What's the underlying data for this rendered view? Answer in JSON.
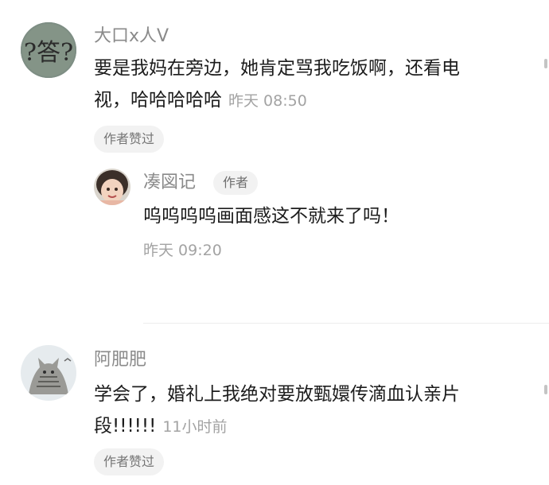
{
  "comments": [
    {
      "username": "大口x人V",
      "lines": [
        "要是我妈在旁边，她肯定骂我吃饭啊，还看电",
        "视，哈哈哈哈哈"
      ],
      "time": "昨天 08:50",
      "badge": "作者赞过",
      "avatar_text": "?答?"
    },
    {
      "username": "阿肥肥",
      "lines": [
        "学会了，婚礼上我绝对要放甄嬛传滴血认亲片",
        "段!!!!!!"
      ],
      "time": "11小时前",
      "badge": "作者赞过"
    }
  ],
  "reply": {
    "username": "凑図记",
    "author_tag": "作者",
    "text": "呜呜呜呜画面感这不就来了吗！",
    "time": "昨天 09:20"
  }
}
